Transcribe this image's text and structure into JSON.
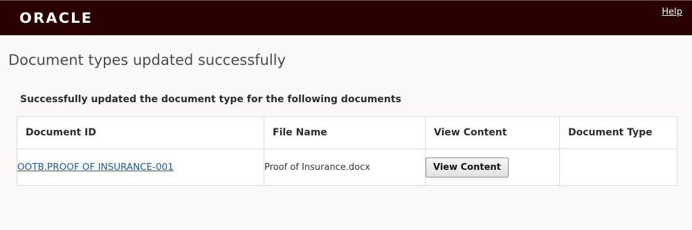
{
  "header": {
    "logo_text": "ORACLE",
    "help_label": "Help"
  },
  "main": {
    "title": "Document types updated successfully",
    "subtitle": "Successfully updated the document type for the following documents",
    "table": {
      "columns": [
        "Document ID",
        "File Name",
        "View Content",
        "Document Type"
      ],
      "rows": [
        {
          "document_id": "OOTB.PROOF OF INSURANCE-001",
          "file_name": "Proof of Insurance.docx",
          "view_button": "View Content",
          "document_type": ""
        }
      ]
    }
  },
  "colors": {
    "header_bg": "#2b0000",
    "page_bg": "#fbf9f8",
    "link": "#1a5a9a"
  }
}
